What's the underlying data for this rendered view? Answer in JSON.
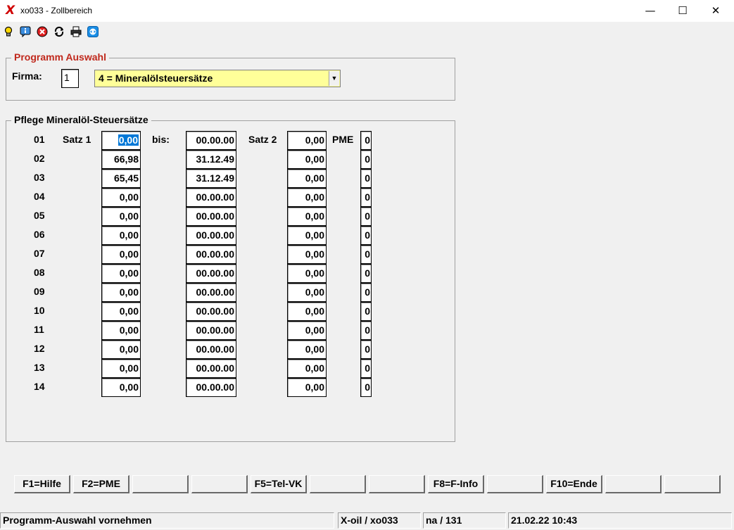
{
  "window": {
    "title": "xo033 - Zollbereich",
    "app_logo": "X",
    "controls": {
      "minimize": "—",
      "maximize": "☐",
      "close": "✕"
    }
  },
  "toolbar": {
    "icons": [
      "lightbulb-icon",
      "info-icon",
      "cancel-icon",
      "refresh-icon",
      "print-icon",
      "teamviewer-icon"
    ]
  },
  "program_selection": {
    "legend": "Programm Auswahl",
    "firma_label": "Firma:",
    "firma_value": "1",
    "program_value": "4 = Mineralölsteuersätze"
  },
  "rates": {
    "legend": "Pflege Mineralöl-Steuersätze",
    "header": {
      "satz1": "Satz 1",
      "bis": "bis:",
      "satz2": "Satz 2",
      "pme": "PME"
    },
    "rows": [
      {
        "nr": "01",
        "satz1": "0,00",
        "bis": "00.00.00",
        "satz2": "0,00",
        "pme": "0"
      },
      {
        "nr": "02",
        "satz1": "66,98",
        "bis": "31.12.49",
        "satz2": "0,00",
        "pme": "0"
      },
      {
        "nr": "03",
        "satz1": "65,45",
        "bis": "31.12.49",
        "satz2": "0,00",
        "pme": "0"
      },
      {
        "nr": "04",
        "satz1": "0,00",
        "bis": "00.00.00",
        "satz2": "0,00",
        "pme": "0"
      },
      {
        "nr": "05",
        "satz1": "0,00",
        "bis": "00.00.00",
        "satz2": "0,00",
        "pme": "0"
      },
      {
        "nr": "06",
        "satz1": "0,00",
        "bis": "00.00.00",
        "satz2": "0,00",
        "pme": "0"
      },
      {
        "nr": "07",
        "satz1": "0,00",
        "bis": "00.00.00",
        "satz2": "0,00",
        "pme": "0"
      },
      {
        "nr": "08",
        "satz1": "0,00",
        "bis": "00.00.00",
        "satz2": "0,00",
        "pme": "0"
      },
      {
        "nr": "09",
        "satz1": "0,00",
        "bis": "00.00.00",
        "satz2": "0,00",
        "pme": "0"
      },
      {
        "nr": "10",
        "satz1": "0,00",
        "bis": "00.00.00",
        "satz2": "0,00",
        "pme": "0"
      },
      {
        "nr": "11",
        "satz1": "0,00",
        "bis": "00.00.00",
        "satz2": "0,00",
        "pme": "0"
      },
      {
        "nr": "12",
        "satz1": "0,00",
        "bis": "00.00.00",
        "satz2": "0,00",
        "pme": "0"
      },
      {
        "nr": "13",
        "satz1": "0,00",
        "bis": "00.00.00",
        "satz2": "0,00",
        "pme": "0"
      },
      {
        "nr": "14",
        "satz1": "0,00",
        "bis": "00.00.00",
        "satz2": "0,00",
        "pme": "0"
      }
    ]
  },
  "function_keys": [
    "F1=Hilfe",
    "F2=PME",
    "",
    "",
    "F5=Tel-VK",
    "",
    "",
    "F8=F-Info",
    "",
    "F10=Ende",
    "",
    ""
  ],
  "statusbar": {
    "message": "Programm-Auswahl vornehmen",
    "program": "X-oil / xo033",
    "user": "na / 131",
    "datetime": "21.02.22 10:43"
  },
  "colors": {
    "legend_red": "#c0281c",
    "combo_bg": "#ffff99",
    "selection": "#0078d7",
    "logo_red": "#d00000"
  }
}
